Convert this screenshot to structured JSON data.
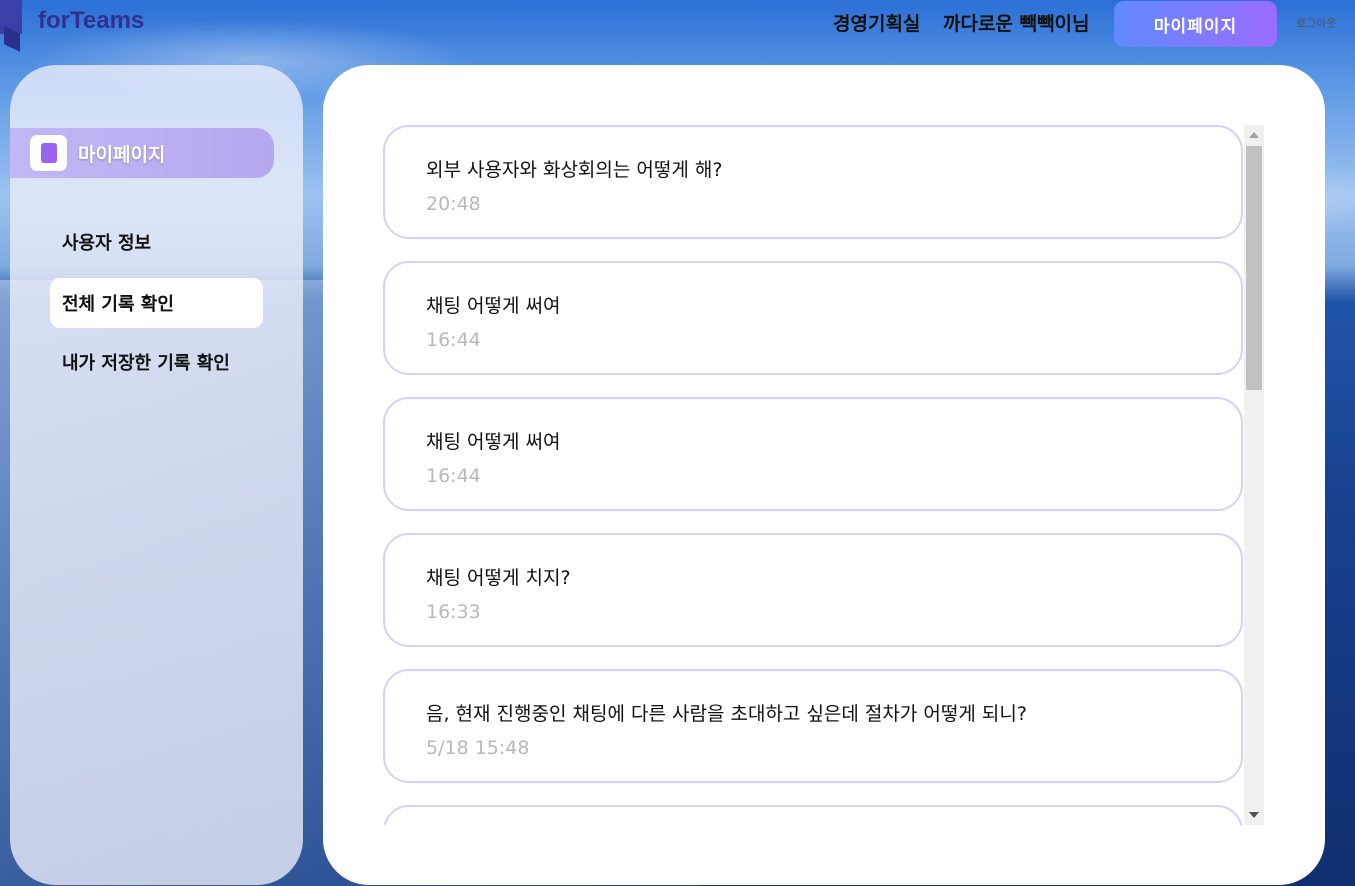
{
  "header": {
    "brand": "forTeams",
    "department": "경영기획실",
    "user_name": "까다로운 빽빽이님",
    "mypage_button": "마이페이지",
    "logout": "로그아웃"
  },
  "sidebar": {
    "title": "마이페이지",
    "items": [
      {
        "label": "사용자 정보",
        "active": false
      },
      {
        "label": "전체 기록 확인",
        "active": true
      },
      {
        "label": "내가 저장한 기록 확인",
        "active": false
      }
    ]
  },
  "history": [
    {
      "text": "외부 사용자와 화상회의는 어떻게 해?",
      "time": "20:48"
    },
    {
      "text": "채팅 어떻게 써여",
      "time": "16:44"
    },
    {
      "text": "채팅 어떻게 써여",
      "time": "16:44"
    },
    {
      "text": "채팅 어떻게 치지?",
      "time": "16:33"
    },
    {
      "text": "음, 현재 진행중인 채팅에 다른 사람을 초대하고 싶은데 절차가 어떻게 되니?",
      "time": "5/18 15:48"
    },
    {
      "text": "",
      "time": ""
    }
  ],
  "colors": {
    "accent_gradient_start": "#5f8bff",
    "accent_gradient_end": "#9b6bff",
    "card_border": "#d4d2f2",
    "time_text": "#b8b8b8"
  },
  "icons": {
    "sidebar_head": "mypage-book-icon",
    "scroll_up": "arrow-up-icon",
    "scroll_down": "arrow-down-icon"
  }
}
